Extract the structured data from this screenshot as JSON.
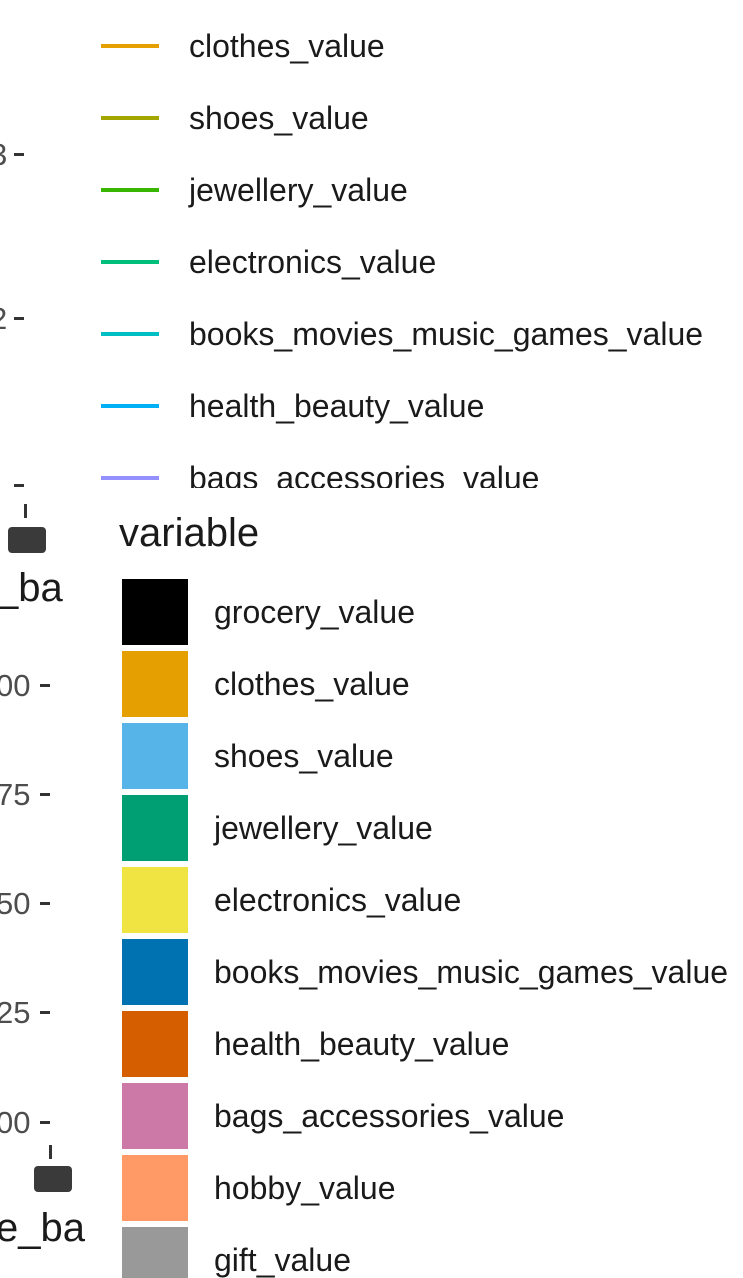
{
  "chart_data": [
    {
      "type": "line",
      "legend": {
        "position": "right",
        "title": "",
        "series": [
          {
            "name": "clothes_value",
            "color": "#E69F00"
          },
          {
            "name": "shoes_value",
            "color": "#A3A500"
          },
          {
            "name": "jewellery_value",
            "color": "#39B600"
          },
          {
            "name": "electronics_value",
            "color": "#00BF7D"
          },
          {
            "name": "books_movies_music_games_value",
            "color": "#00BFC4"
          },
          {
            "name": "health_beauty_value",
            "color": "#00B0F6"
          },
          {
            "name": "bags_accessories_value",
            "color": "#9590FF"
          }
        ]
      },
      "y_tick_labels": [
        "3",
        "2"
      ],
      "x_label_fragment": "_ba"
    },
    {
      "type": "bar",
      "legend": {
        "position": "right",
        "title": "variable",
        "series": [
          {
            "name": "grocery_value",
            "color": "#000000"
          },
          {
            "name": "clothes_value",
            "color": "#E69F00"
          },
          {
            "name": "shoes_value",
            "color": "#56B4E9"
          },
          {
            "name": "jewellery_value",
            "color": "#009E73"
          },
          {
            "name": "electronics_value",
            "color": "#F0E442"
          },
          {
            "name": "books_movies_music_games_value",
            "color": "#0072B2"
          },
          {
            "name": "health_beauty_value",
            "color": "#D55E00"
          },
          {
            "name": "bags_accessories_value",
            "color": "#CC79A7"
          },
          {
            "name": "hobby_value",
            "color": "#FF9966"
          },
          {
            "name": "gift_value",
            "color": "#999999"
          }
        ]
      },
      "y_tick_labels": [
        "00",
        "75",
        "50",
        "25",
        "00"
      ],
      "x_label_fragment": "e_ba"
    }
  ]
}
